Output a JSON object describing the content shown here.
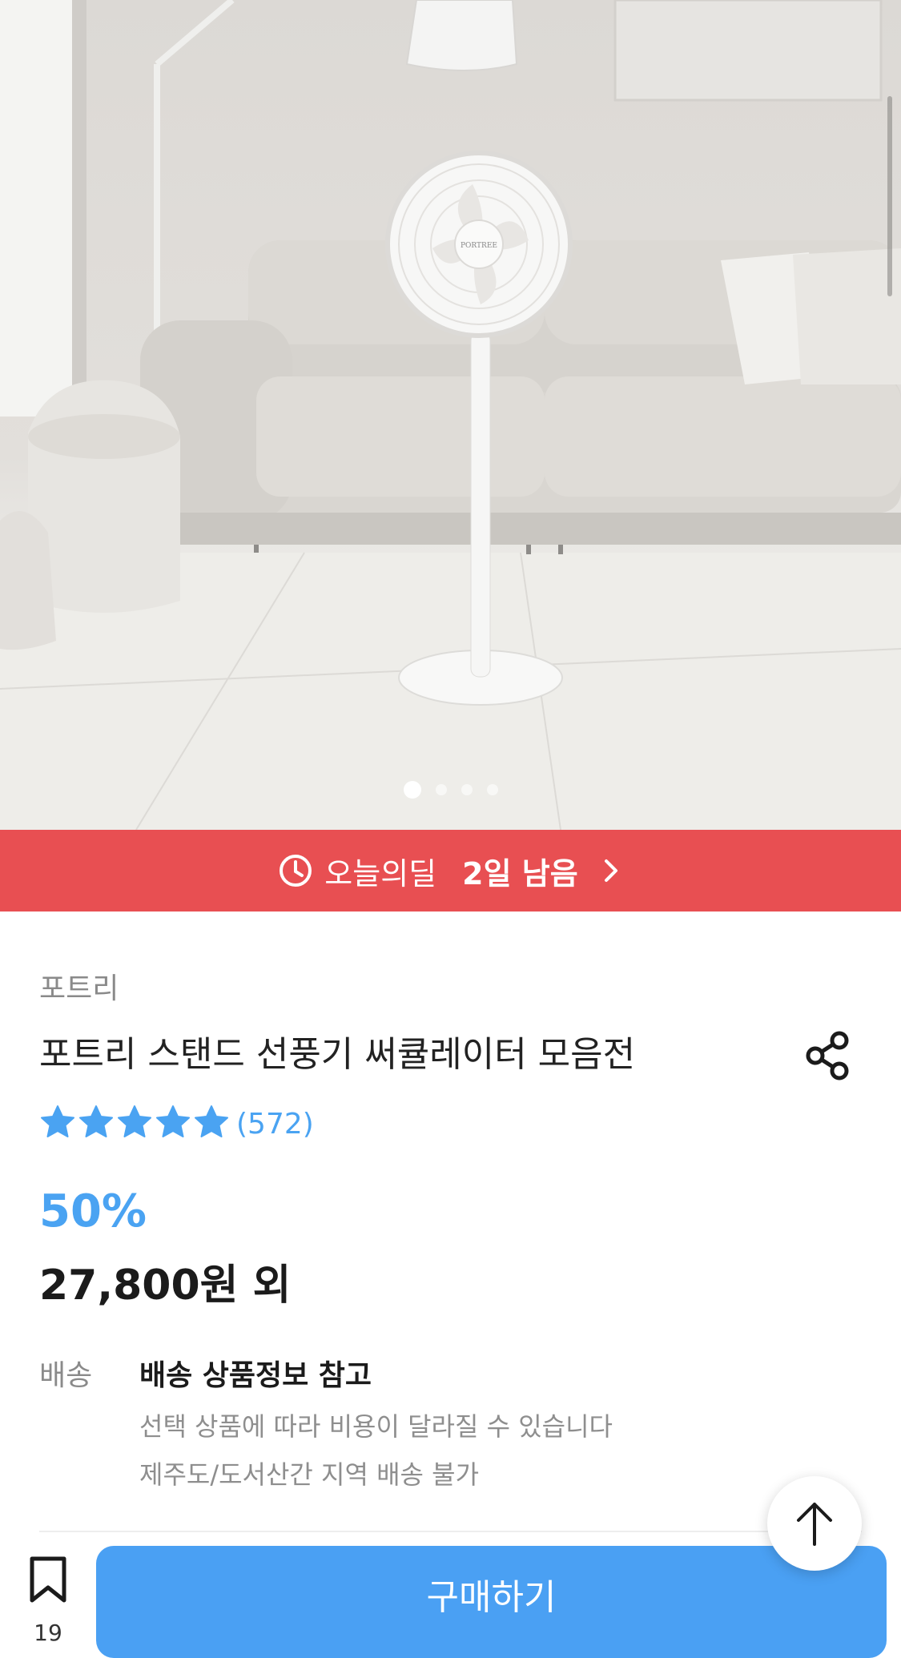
{
  "colors": {
    "deal_banner": "#e84f52",
    "accent_blue": "#4aa3f2",
    "buy_button": "#4aa0f3"
  },
  "hero": {
    "slide_count": 4,
    "active_slide": 1,
    "logo_text": "PORTREE"
  },
  "deal_banner": {
    "icon": "clock-icon",
    "label": "오늘의딜",
    "remaining": "2일 남음",
    "chevron": "chevron-right-icon"
  },
  "product": {
    "brand": "포트리",
    "title": "포트리 스탠드 선풍기 써큘레이터 모음전",
    "rating_stars": 5,
    "review_count": "(572)",
    "discount": "50%",
    "price": "27,800원 외"
  },
  "shipping": {
    "label": "배송",
    "title": "배송 상품정보 참고",
    "note1": "선택 상품에 따라 비용이 달라질 수 있습니다",
    "note2": "제주도/도서산간 지역 배송 불가"
  },
  "bottom_bar": {
    "bookmark_count": "19",
    "buy_label": "구매하기"
  }
}
